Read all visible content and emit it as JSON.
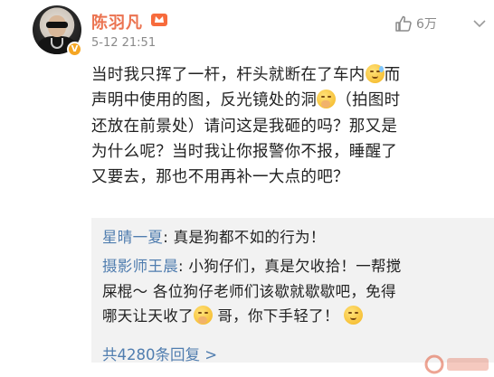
{
  "post": {
    "username": "陈羽凡",
    "timestamp": "5-12 21:51",
    "like_count": "6万",
    "text": {
      "line1_a": "当时我只挥了一杆，杆头就断在了车内",
      "line1_b": "而",
      "line2_a": "声明中使用的图，反光镜处的洞",
      "line2_b": "（拍图时",
      "line3": "还放在前景处）请问这是我砸的吗？那又是",
      "line4": "为什么呢？当时我让你报警你不报，睡醒了",
      "line5": "又要去，那也不用再补一大点的吧？"
    }
  },
  "replies": {
    "items": [
      {
        "author": "星晴一夏",
        "sep": ": ",
        "text": "真是狗都不如的行为！"
      },
      {
        "author": "摄影师王晨",
        "sep": ": ",
        "text_a": "小狗仔们，真是欠收拾！一帮搅",
        "text_b": "屎棍～ 各位狗仔老师们该歇就歇歇吧，免得",
        "text_c": "哪天让天收了",
        "text_d": " 哥，你下手轻了！"
      }
    ],
    "more_label": "共4280条回复 >"
  },
  "icons": {
    "like": "thumbs-up-icon",
    "menu": "chevron-down-icon",
    "verified": "verified-badge-icon",
    "member": "member-crown-icon"
  },
  "colors": {
    "username": "#eb7350",
    "link": "#507daf",
    "reply_bg": "#f2f2f2",
    "verified": "#f5a623"
  }
}
